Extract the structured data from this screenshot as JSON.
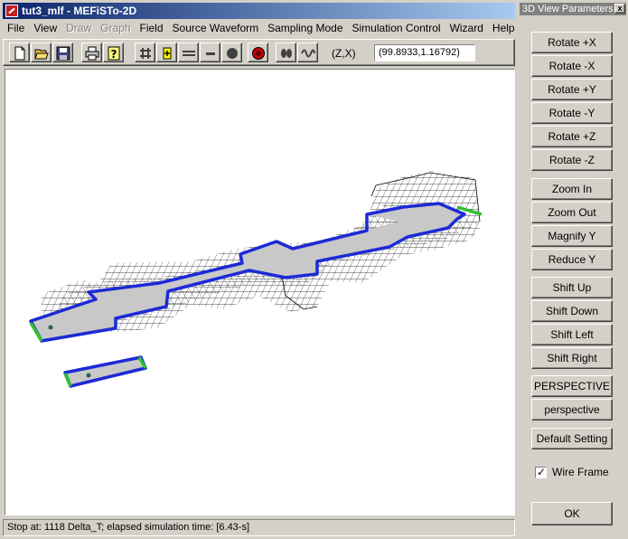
{
  "window": {
    "title": "tut3_mlf - MEFiSTo-2D"
  },
  "menu": [
    {
      "label": "File",
      "enabled": true
    },
    {
      "label": "View",
      "enabled": true
    },
    {
      "label": "Draw",
      "enabled": false
    },
    {
      "label": "Graph",
      "enabled": false
    },
    {
      "label": "Field",
      "enabled": true
    },
    {
      "label": "Source Waveform",
      "enabled": true
    },
    {
      "label": "Sampling Mode",
      "enabled": true
    },
    {
      "label": "Simulation Control",
      "enabled": true
    },
    {
      "label": "Wizard",
      "enabled": true
    },
    {
      "label": "Help",
      "enabled": true
    }
  ],
  "toolbar": {
    "buttons": [
      "new-file-icon",
      "open-folder-icon",
      "save-disk-icon",
      "print-icon",
      "help-question-icon",
      "grid-icon",
      "plus-source-icon",
      "line-icon",
      "minus-icon",
      "circle-icon",
      "record-icon",
      "probe-icon",
      "waveform-icon"
    ],
    "coord_label": "(Z,X)",
    "coord_value": "(99.8933,1.16792)"
  },
  "status": {
    "text": "Stop at: 1118 Delta_T;   elapsed simulation time: [6.43-s]"
  },
  "panel": {
    "title": "3D View Parameters",
    "close_glyph": "x",
    "buttons": [
      "Rotate +X",
      "Rotate -X",
      "Rotate +Y",
      "Rotate -Y",
      "Rotate +Z",
      "Rotate -Z",
      "Zoom In",
      "Zoom Out",
      "Magnify Y",
      "Reduce Y",
      "Shift Up",
      "Shift Down",
      "Shift Left",
      "Shift Right",
      "PERSPECTIVE",
      "perspective",
      "Default Setting"
    ],
    "wireframe": {
      "label": "Wire Frame",
      "checked": true
    },
    "ok_label": "OK"
  },
  "colors": {
    "conductor": "#1c2ad6",
    "port": "#2fbf2f",
    "surface": "#c0c0c0"
  }
}
